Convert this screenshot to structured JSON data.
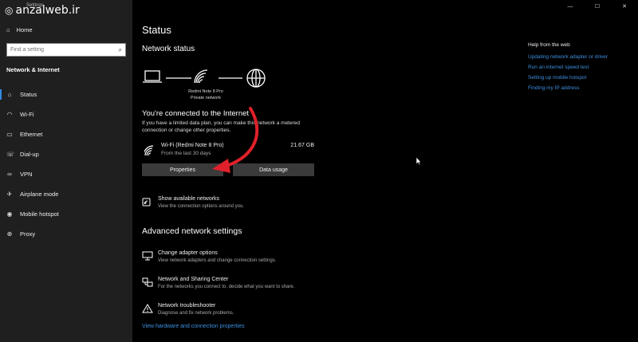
{
  "window": {
    "title": "Settings",
    "minimize": "—",
    "maximize": "☐",
    "watermark": "anzalweb.ir"
  },
  "sidebar": {
    "home_label": "Home",
    "search_placeholder": "Find a setting",
    "section_label": "Network & Internet",
    "items": [
      {
        "label": "Status",
        "icon": "status-icon"
      },
      {
        "label": "Wi-Fi",
        "icon": "wifi-icon"
      },
      {
        "label": "Ethernet",
        "icon": "ethernet-icon"
      },
      {
        "label": "Dial-up",
        "icon": "dialup-icon"
      },
      {
        "label": "VPN",
        "icon": "vpn-icon"
      },
      {
        "label": "Airplane mode",
        "icon": "airplane-icon"
      },
      {
        "label": "Mobile hotspot",
        "icon": "hotspot-icon"
      },
      {
        "label": "Proxy",
        "icon": "proxy-icon"
      }
    ]
  },
  "main": {
    "title": "Status",
    "network_status_label": "Network status",
    "network_name": "Redmi Note 8 Pro",
    "network_type": "Private network",
    "connected_title": "You're connected to the Internet",
    "connected_desc": "If you have a limited data plan, you can make this network a metered connection or change other properties.",
    "wifi": {
      "name": "Wi-Fi (Redmi Note 8 Pro)",
      "period": "From the last 30 days",
      "usage": "21.67 GB"
    },
    "properties_button": "Properties",
    "data_usage_button": "Data usage",
    "show_networks": {
      "title": "Show available networks",
      "desc": "View the connection options around you."
    },
    "advanced_title": "Advanced network settings",
    "advanced": [
      {
        "title": "Change adapter options",
        "desc": "View network adapters and change connection settings.",
        "icon": "adapter-icon"
      },
      {
        "title": "Network and Sharing Center",
        "desc": "For the networks you connect to, decide what you want to share.",
        "icon": "sharing-icon"
      },
      {
        "title": "Network troubleshooter",
        "desc": "Diagnose and fix network problems.",
        "icon": "warning-icon"
      }
    ],
    "hardware_link": "View hardware and connection properties"
  },
  "help": {
    "title": "Help from the web",
    "links": [
      "Updating network adapter or driver",
      "Run an internet speed test",
      "Setting up mobile hotspot",
      "Finding my IP address"
    ]
  },
  "colors": {
    "accent": "#3d8fe0",
    "annotation_arrow": "#e0202a"
  }
}
